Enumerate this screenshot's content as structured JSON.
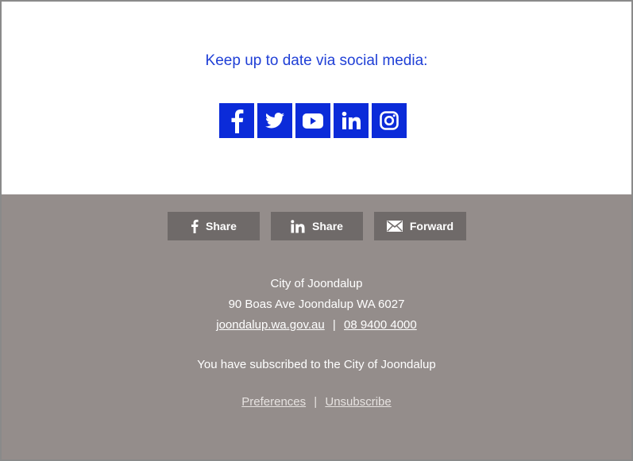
{
  "social": {
    "heading": "Keep up to date via social media:",
    "icons": [
      "facebook-icon",
      "twitter-icon",
      "youtube-icon",
      "linkedin-icon",
      "instagram-icon"
    ],
    "accent": "#0b2bd9"
  },
  "share": {
    "facebook_label": "Share",
    "linkedin_label": "Share",
    "forward_label": "Forward"
  },
  "footer": {
    "org_name": "City of Joondalup",
    "address": "90 Boas Ave Joondalup WA 6027",
    "website": "joondalup.wa.gov.au",
    "separator": "|",
    "phone": "08 9400 4000",
    "subscribed_text": "You have subscribed to the City of Joondalup",
    "preferences_label": "Preferences",
    "links_separator": "|",
    "unsubscribe_label": "Unsubscribe",
    "background": "#948d8b"
  }
}
